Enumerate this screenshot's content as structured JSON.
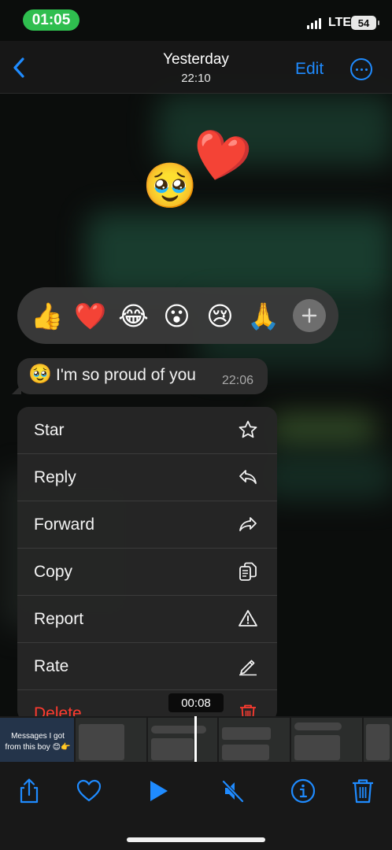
{
  "status_bar": {
    "time": "01:05",
    "network": "LTE",
    "battery": "54"
  },
  "nav": {
    "title": "Yesterday",
    "subtitle": "22:10",
    "edit_label": "Edit",
    "back_icon": "chevron-left-icon",
    "more_icon": "ellipsis-circle-icon"
  },
  "reactions": [
    "👍",
    "❤️",
    "😂",
    "😮",
    "😢",
    "🙏"
  ],
  "big_emojis": {
    "face": "🥹",
    "heart": "❤️"
  },
  "message": {
    "emoji": "🥹",
    "text": "I'm so proud of you",
    "time": "22:06"
  },
  "menu": {
    "items": [
      {
        "label": "Star",
        "icon": "star-icon"
      },
      {
        "label": "Reply",
        "icon": "reply-icon"
      },
      {
        "label": "Forward",
        "icon": "forward-icon"
      },
      {
        "label": "Copy",
        "icon": "copy-icon"
      },
      {
        "label": "Report",
        "icon": "warning-icon"
      },
      {
        "label": "Rate",
        "icon": "pencil-icon"
      },
      {
        "label": "Delete",
        "icon": "trash-icon"
      }
    ]
  },
  "video": {
    "duration": "00:08",
    "thumb_caption": "Messages I got from this boy 😊👉"
  },
  "toolbar": {
    "icons": [
      "share-icon",
      "heart-icon",
      "play-icon",
      "mute-icon",
      "info-icon",
      "trash-icon"
    ]
  },
  "colors": {
    "accent": "#1f8bff",
    "status_green": "#2fbe4f",
    "danger": "#ff3b30"
  }
}
